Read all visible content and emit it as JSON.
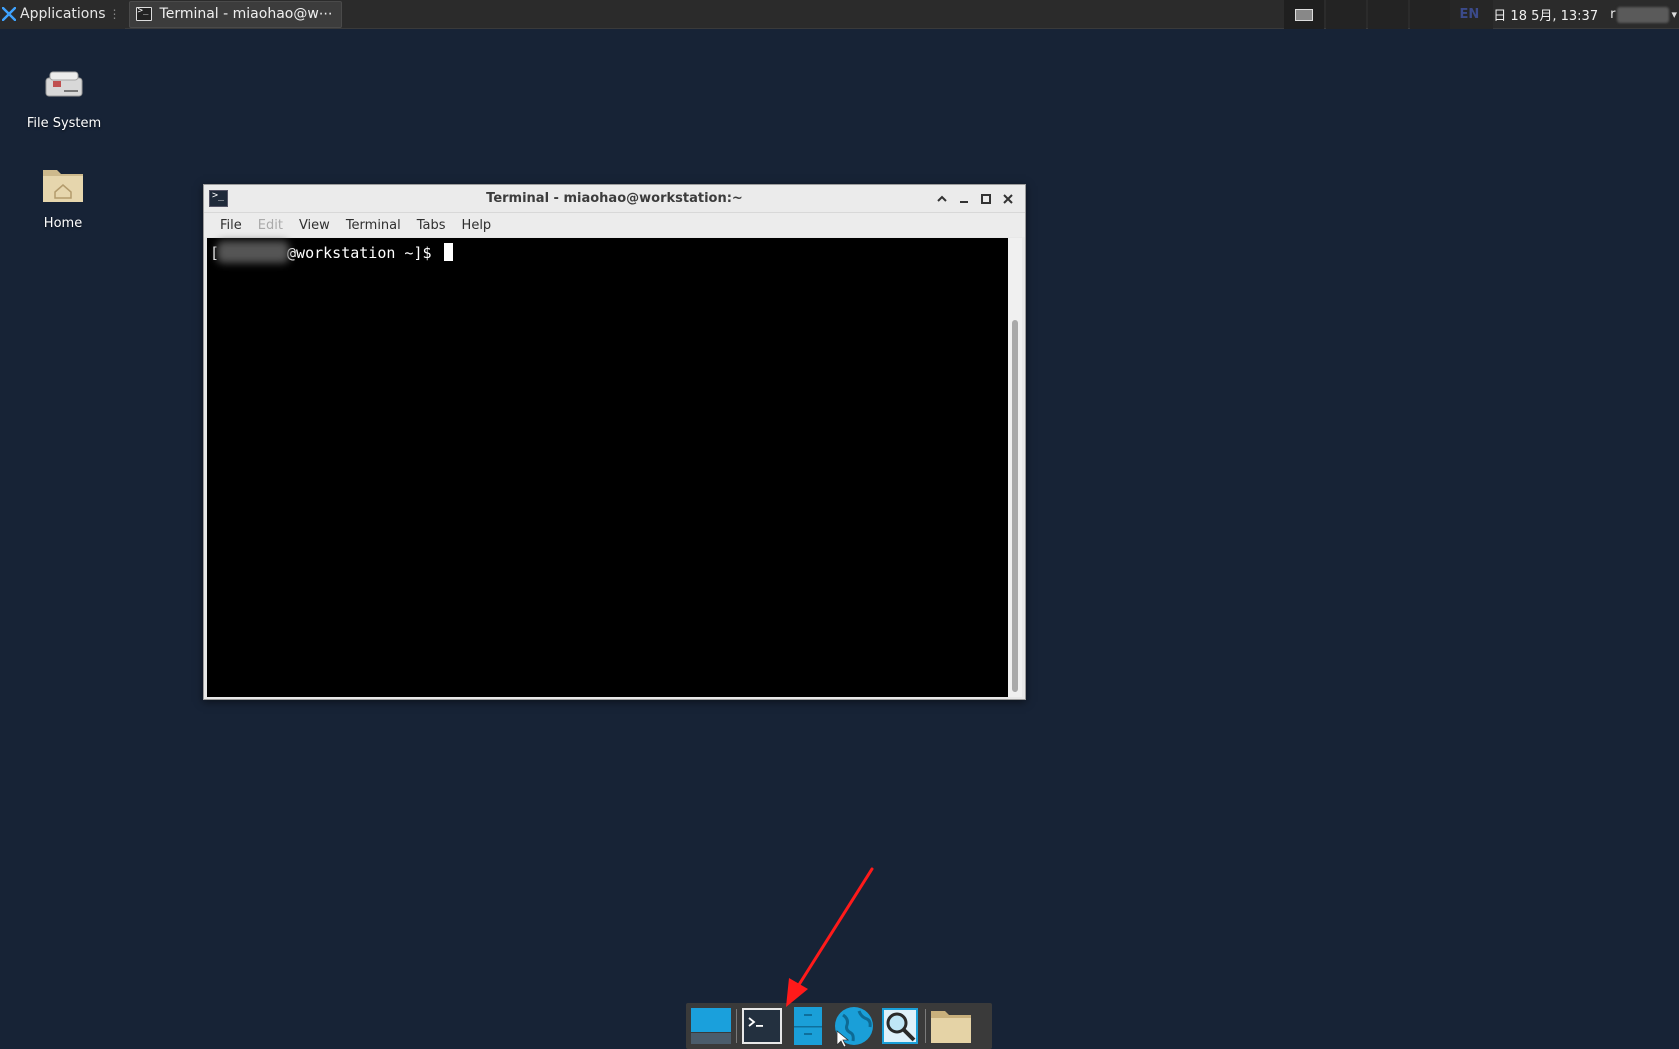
{
  "top_panel": {
    "applications_label": "Applications",
    "task_title": "Terminal - miaohao@w⋯",
    "lang": "EN",
    "clock": "日 18 5月, 13:37",
    "user_initial": "r"
  },
  "desktop": {
    "icons": [
      {
        "label": "File System",
        "icon": "drive-icon"
      },
      {
        "label": "Home",
        "icon": "home-folder-icon"
      }
    ]
  },
  "terminal_window": {
    "title": "Terminal - miaohao@workstation:~",
    "menu": [
      "File",
      "Edit",
      "View",
      "Terminal",
      "Tabs",
      "Help"
    ],
    "prompt_open": "[",
    "prompt_rest": "@workstation ~]$"
  },
  "dock": {
    "items": [
      {
        "name": "show-desktop",
        "icon": "desktop-icon"
      },
      {
        "name": "terminal",
        "icon": "terminal-icon"
      },
      {
        "name": "file-manager",
        "icon": "file-cabinet-icon"
      },
      {
        "name": "web-browser",
        "icon": "globe-icon"
      },
      {
        "name": "app-finder",
        "icon": "magnifier-icon"
      },
      {
        "name": "home-folder",
        "icon": "folder-icon"
      }
    ]
  },
  "colors": {
    "desktop_bg": "#172336",
    "arrow": "#ff1a1a",
    "accent_blue": "#1a9fd8"
  }
}
